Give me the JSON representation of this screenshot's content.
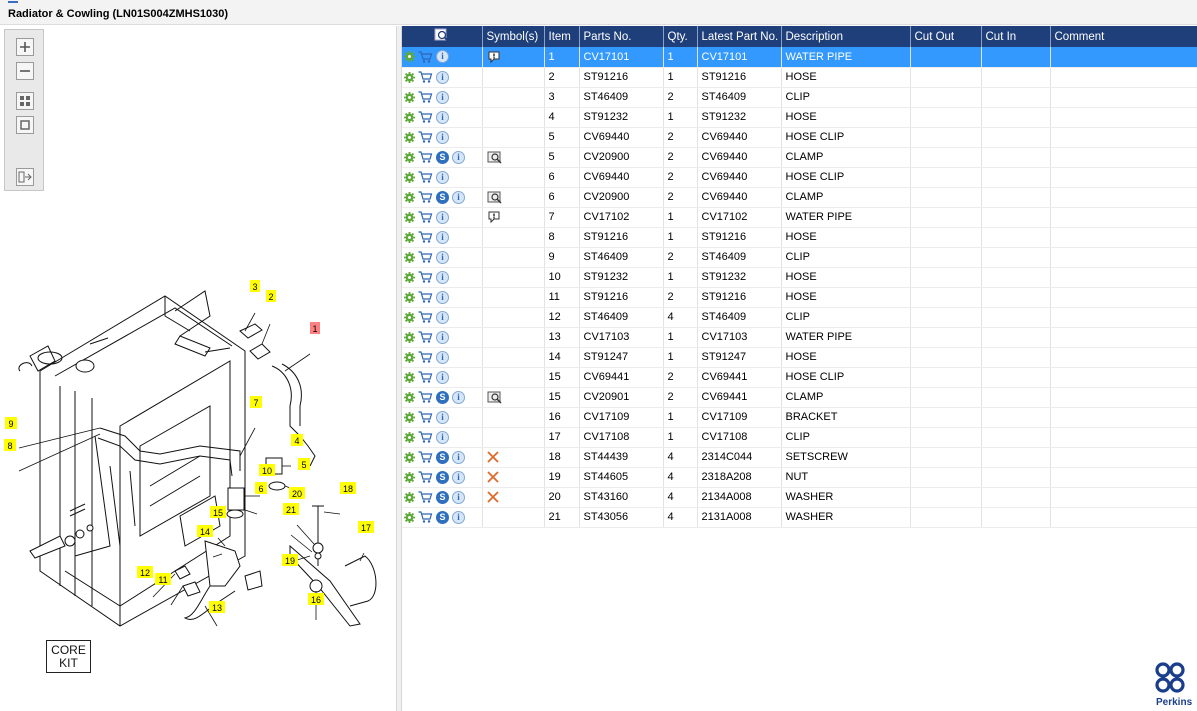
{
  "window": {
    "title": "Radiator & Cowling (LN01S004ZMHS1030)"
  },
  "toolbox": {
    "tools": [
      "zoom-in",
      "zoom-out",
      "fit-all",
      "actual-size",
      "export"
    ]
  },
  "diagram": {
    "core_kit_line1": "CORE",
    "core_kit_line2": "KIT",
    "callouts": [
      "1",
      "2",
      "3",
      "4",
      "5",
      "6",
      "7",
      "8",
      "9",
      "10",
      "11",
      "12",
      "13",
      "14",
      "15",
      "16",
      "17",
      "18",
      "19",
      "20",
      "21"
    ]
  },
  "table": {
    "columns": {
      "symbols": "Symbol(s)",
      "item": "Item",
      "parts_no": "Parts No.",
      "qty": "Qty.",
      "latest": "Latest Part No.",
      "description": "Description",
      "cut_out": "Cut Out",
      "cut_in": "Cut In",
      "comment": "Comment"
    },
    "rows": [
      {
        "s": false,
        "sym": "note",
        "item": "1",
        "part": "CV17101",
        "qty": "1",
        "latest": "CV17101",
        "desc": "WATER PIPE"
      },
      {
        "s": false,
        "sym": "",
        "item": "2",
        "part": "ST91216",
        "qty": "1",
        "latest": "ST91216",
        "desc": "HOSE"
      },
      {
        "s": false,
        "sym": "",
        "item": "3",
        "part": "ST46409",
        "qty": "2",
        "latest": "ST46409",
        "desc": "CLIP"
      },
      {
        "s": false,
        "sym": "",
        "item": "4",
        "part": "ST91232",
        "qty": "1",
        "latest": "ST91232",
        "desc": "HOSE"
      },
      {
        "s": false,
        "sym": "",
        "item": "5",
        "part": "CV69440",
        "qty": "2",
        "latest": "CV69440",
        "desc": "HOSE CLIP"
      },
      {
        "s": true,
        "sym": "view",
        "item": "5",
        "part": "CV20900",
        "qty": "2",
        "latest": "CV69440",
        "desc": "CLAMP"
      },
      {
        "s": false,
        "sym": "",
        "item": "6",
        "part": "CV69440",
        "qty": "2",
        "latest": "CV69440",
        "desc": "HOSE CLIP"
      },
      {
        "s": true,
        "sym": "view",
        "item": "6",
        "part": "CV20900",
        "qty": "2",
        "latest": "CV69440",
        "desc": "CLAMP"
      },
      {
        "s": false,
        "sym": "note",
        "item": "7",
        "part": "CV17102",
        "qty": "1",
        "latest": "CV17102",
        "desc": "WATER PIPE"
      },
      {
        "s": false,
        "sym": "",
        "item": "8",
        "part": "ST91216",
        "qty": "1",
        "latest": "ST91216",
        "desc": "HOSE"
      },
      {
        "s": false,
        "sym": "",
        "item": "9",
        "part": "ST46409",
        "qty": "2",
        "latest": "ST46409",
        "desc": "CLIP"
      },
      {
        "s": false,
        "sym": "",
        "item": "10",
        "part": "ST91232",
        "qty": "1",
        "latest": "ST91232",
        "desc": "HOSE"
      },
      {
        "s": false,
        "sym": "",
        "item": "11",
        "part": "ST91216",
        "qty": "2",
        "latest": "ST91216",
        "desc": "HOSE"
      },
      {
        "s": false,
        "sym": "",
        "item": "12",
        "part": "ST46409",
        "qty": "4",
        "latest": "ST46409",
        "desc": "CLIP"
      },
      {
        "s": false,
        "sym": "",
        "item": "13",
        "part": "CV17103",
        "qty": "1",
        "latest": "CV17103",
        "desc": "WATER PIPE"
      },
      {
        "s": false,
        "sym": "",
        "item": "14",
        "part": "ST91247",
        "qty": "1",
        "latest": "ST91247",
        "desc": "HOSE"
      },
      {
        "s": false,
        "sym": "",
        "item": "15",
        "part": "CV69441",
        "qty": "2",
        "latest": "CV69441",
        "desc": "HOSE CLIP"
      },
      {
        "s": true,
        "sym": "view",
        "item": "15",
        "part": "CV20901",
        "qty": "2",
        "latest": "CV69441",
        "desc": "CLAMP"
      },
      {
        "s": false,
        "sym": "",
        "item": "16",
        "part": "CV17109",
        "qty": "1",
        "latest": "CV17109",
        "desc": "BRACKET"
      },
      {
        "s": false,
        "sym": "",
        "item": "17",
        "part": "CV17108",
        "qty": "1",
        "latest": "CV17108",
        "desc": "CLIP"
      },
      {
        "s": true,
        "sym": "cross",
        "item": "18",
        "part": "ST44439",
        "qty": "4",
        "latest": "2314C044",
        "desc": "SETSCREW"
      },
      {
        "s": true,
        "sym": "cross",
        "item": "19",
        "part": "ST44605",
        "qty": "4",
        "latest": "2318A208",
        "desc": "NUT"
      },
      {
        "s": true,
        "sym": "cross",
        "item": "20",
        "part": "ST43160",
        "qty": "4",
        "latest": "2134A008",
        "desc": "WASHER"
      },
      {
        "s": true,
        "sym": "",
        "item": "21",
        "part": "ST43056",
        "qty": "4",
        "latest": "2131A008",
        "desc": "WASHER"
      }
    ],
    "selected_index": 0
  },
  "brand": {
    "name": "Perkins",
    "color": "#1a3e8c"
  },
  "colors": {
    "header": "#1f3f7b",
    "selected": "#3399ff",
    "callout_yellow": "#ffff00",
    "callout_red": "#ff8080"
  }
}
